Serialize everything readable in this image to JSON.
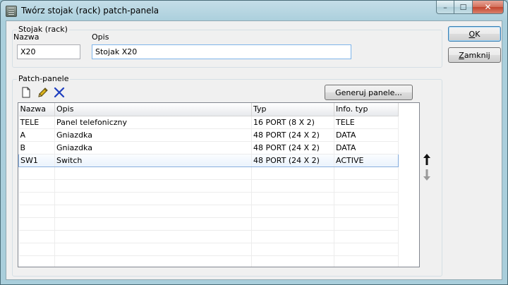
{
  "window": {
    "title": "Twórz stojak (rack) patch-panela",
    "controls": {
      "minimize": "–",
      "maximize": "☐",
      "close": "✕"
    }
  },
  "rack": {
    "group_label": "Stojak (rack)",
    "name_label": "Nazwa",
    "name_value": "X20",
    "desc_label": "Opis",
    "desc_value": "Stojak X20"
  },
  "buttons": {
    "ok": {
      "underline": "O",
      "rest": "K"
    },
    "close": {
      "underline": "Z",
      "rest": "amknij"
    }
  },
  "panels": {
    "group_label": "Patch-panele",
    "generate_label": "Generuj panele...",
    "columns": [
      "Nazwa",
      "Opis",
      "Typ",
      "Info. typ"
    ],
    "rows": [
      [
        "TELE",
        "Panel telefoniczny",
        "16 PORT (8 X 2)",
        "TELE"
      ],
      [
        "A",
        "Gniazdka",
        "48 PORT (24 X 2)",
        "DATA"
      ],
      [
        "B",
        "Gniazdka",
        "48 PORT (24 X 2)",
        "DATA"
      ],
      [
        "SW1",
        "Switch",
        "48 PORT (24 X 2)",
        "ACTIVE"
      ]
    ],
    "selected_row": 3
  },
  "icons": {
    "app": "rack-app-icon",
    "new": "new-document-icon",
    "edit": "pencil-icon",
    "delete": "delete-x-icon",
    "up": "arrow-up-icon",
    "down": "arrow-down-icon"
  },
  "colors": {
    "delete_icon": "#1f3fbf",
    "pencil": "#d9b11c",
    "selection_border": "#84acdd"
  }
}
